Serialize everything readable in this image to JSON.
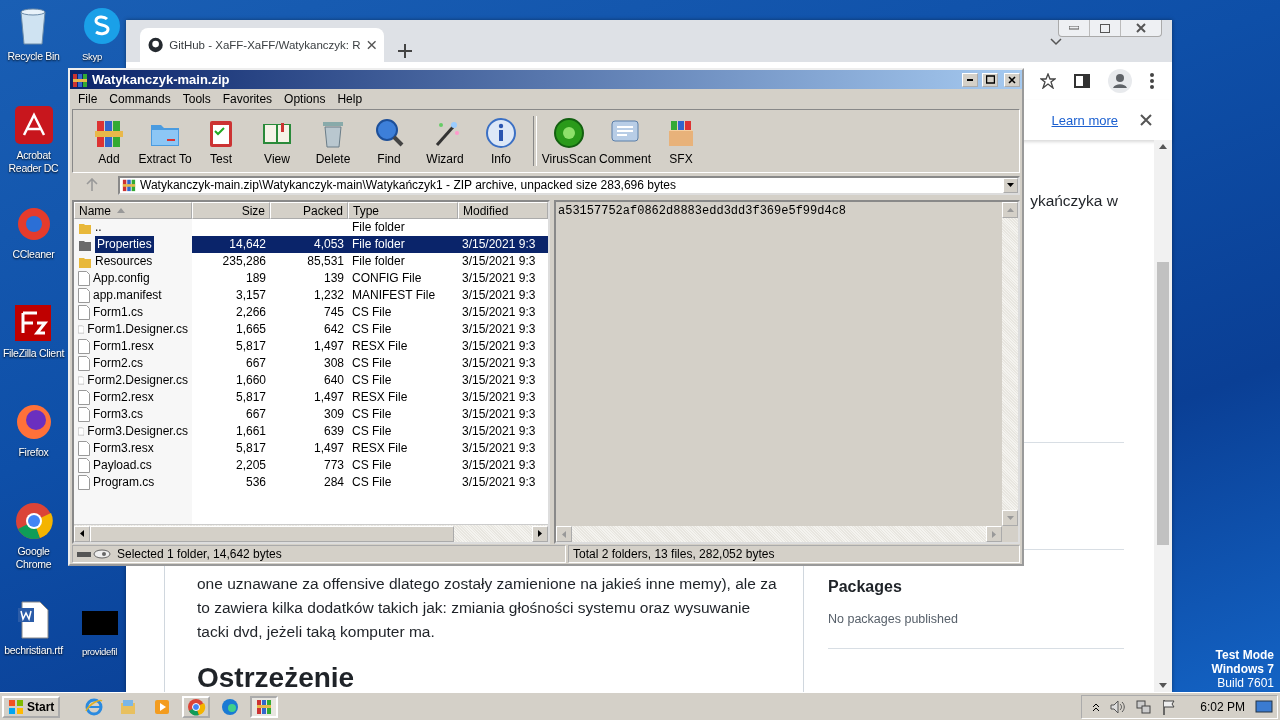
{
  "desktop": {
    "column_1": [
      {
        "label": "Recycle Bin",
        "kind": "recycle"
      },
      {
        "label": "Acrobat Reader DC",
        "kind": "acrobat"
      },
      {
        "label": "CCleaner",
        "kind": "ccleaner"
      },
      {
        "label": "FileZilla Client",
        "kind": "filezilla"
      },
      {
        "label": "Firefox",
        "kind": "firefox"
      },
      {
        "label": "Google Chrome",
        "kind": "chrome"
      },
      {
        "label": "bechristian.rtf",
        "kind": "word"
      }
    ],
    "column_2": [
      {
        "label": "Skyp",
        "kind": "skype"
      },
      {
        "label": "providefil",
        "kind": "blackfile"
      }
    ]
  },
  "browser": {
    "tab_title": "GitHub - XaFF-XaFF/Watykanczyk: R",
    "banner_link": "Learn more",
    "readme_lines": [
      "one uznawane za offensive dlatego zostały zamienione na jakieś inne memy), ale za",
      "to zawiera kilka dodatków takich jak: zmiania głośności systemu oraz wysuwanie",
      "tacki dvd, jeżeli taką komputer ma."
    ],
    "heading": "Ostrzeżenie",
    "sidebar": {
      "about_fragment": "ykańczyka w",
      "title": "Packages",
      "text": "No packages published"
    }
  },
  "winrar": {
    "title": "Watykanczyk-main.zip",
    "menu": [
      "File",
      "Commands",
      "Tools",
      "Favorites",
      "Options",
      "Help"
    ],
    "toolbar": [
      {
        "label": "Add",
        "kind": "add"
      },
      {
        "label": "Extract To",
        "kind": "extract"
      },
      {
        "label": "Test",
        "kind": "test"
      },
      {
        "label": "View",
        "kind": "view"
      },
      {
        "label": "Delete",
        "kind": "delete"
      },
      {
        "label": "Find",
        "kind": "find"
      },
      {
        "label": "Wizard",
        "kind": "wizard"
      },
      {
        "label": "Info",
        "kind": "info"
      },
      {
        "label": "VirusScan",
        "kind": "virus"
      },
      {
        "label": "Comment",
        "kind": "comment"
      },
      {
        "label": "SFX",
        "kind": "sfx"
      }
    ],
    "path": "Watykanczyk-main.zip\\Watykanczyk-main\\Watykańczyk1 - ZIP archive, unpacked size 283,696 bytes",
    "columns": [
      "Name",
      "Size",
      "Packed",
      "Type",
      "Modified"
    ],
    "rows": [
      {
        "name": "..",
        "type": "File folder",
        "kind": "folder",
        "selected": false
      },
      {
        "name": "Properties",
        "size": "14,642",
        "packed": "4,053",
        "type": "File folder",
        "modified": "3/15/2021 9:3",
        "kind": "folder",
        "selected": true
      },
      {
        "name": "Resources",
        "size": "235,286",
        "packed": "85,531",
        "type": "File folder",
        "modified": "3/15/2021 9:3",
        "kind": "folder",
        "selected": false
      },
      {
        "name": "App.config",
        "size": "189",
        "packed": "139",
        "type": "CONFIG File",
        "modified": "3/15/2021 9:3",
        "kind": "file",
        "selected": false
      },
      {
        "name": "app.manifest",
        "size": "3,157",
        "packed": "1,232",
        "type": "MANIFEST File",
        "modified": "3/15/2021 9:3",
        "kind": "file",
        "selected": false
      },
      {
        "name": "Form1.cs",
        "size": "2,266",
        "packed": "745",
        "type": "CS File",
        "modified": "3/15/2021 9:3",
        "kind": "file",
        "selected": false
      },
      {
        "name": "Form1.Designer.cs",
        "size": "1,665",
        "packed": "642",
        "type": "CS File",
        "modified": "3/15/2021 9:3",
        "kind": "file",
        "selected": false
      },
      {
        "name": "Form1.resx",
        "size": "5,817",
        "packed": "1,497",
        "type": "RESX File",
        "modified": "3/15/2021 9:3",
        "kind": "file",
        "selected": false
      },
      {
        "name": "Form2.cs",
        "size": "667",
        "packed": "308",
        "type": "CS File",
        "modified": "3/15/2021 9:3",
        "kind": "file",
        "selected": false
      },
      {
        "name": "Form2.Designer.cs",
        "size": "1,660",
        "packed": "640",
        "type": "CS File",
        "modified": "3/15/2021 9:3",
        "kind": "file",
        "selected": false
      },
      {
        "name": "Form2.resx",
        "size": "5,817",
        "packed": "1,497",
        "type": "RESX File",
        "modified": "3/15/2021 9:3",
        "kind": "file",
        "selected": false
      },
      {
        "name": "Form3.cs",
        "size": "667",
        "packed": "309",
        "type": "CS File",
        "modified": "3/15/2021 9:3",
        "kind": "file",
        "selected": false
      },
      {
        "name": "Form3.Designer.cs",
        "size": "1,661",
        "packed": "639",
        "type": "CS File",
        "modified": "3/15/2021 9:3",
        "kind": "file",
        "selected": false
      },
      {
        "name": "Form3.resx",
        "size": "5,817",
        "packed": "1,497",
        "type": "RESX File",
        "modified": "3/15/2021 9:3",
        "kind": "file",
        "selected": false
      },
      {
        "name": "Payload.cs",
        "size": "2,205",
        "packed": "773",
        "type": "CS File",
        "modified": "3/15/2021 9:3",
        "kind": "file",
        "selected": false
      },
      {
        "name": "Program.cs",
        "size": "536",
        "packed": "284",
        "type": "CS File",
        "modified": "3/15/2021 9:3",
        "kind": "file",
        "selected": false
      }
    ],
    "comment": "a53157752af0862d8883edd3dd3f369e5f99d4c8",
    "status_left": "Selected 1 folder, 14,642 bytes",
    "status_right": "Total 2 folders, 13 files, 282,052 bytes"
  },
  "taskbar": {
    "start": "Start",
    "apps": [
      {
        "kind": "ie",
        "selected": false
      },
      {
        "kind": "explorer",
        "selected": false
      },
      {
        "kind": "media",
        "selected": false
      },
      {
        "kind": "chrome",
        "selected": false
      },
      {
        "kind": "edge",
        "selected": false
      },
      {
        "kind": "winrar",
        "selected": true
      }
    ],
    "clock": "6:02 PM"
  },
  "os_notice": [
    "Test Mode",
    "Windows 7",
    "Build 7601"
  ]
}
